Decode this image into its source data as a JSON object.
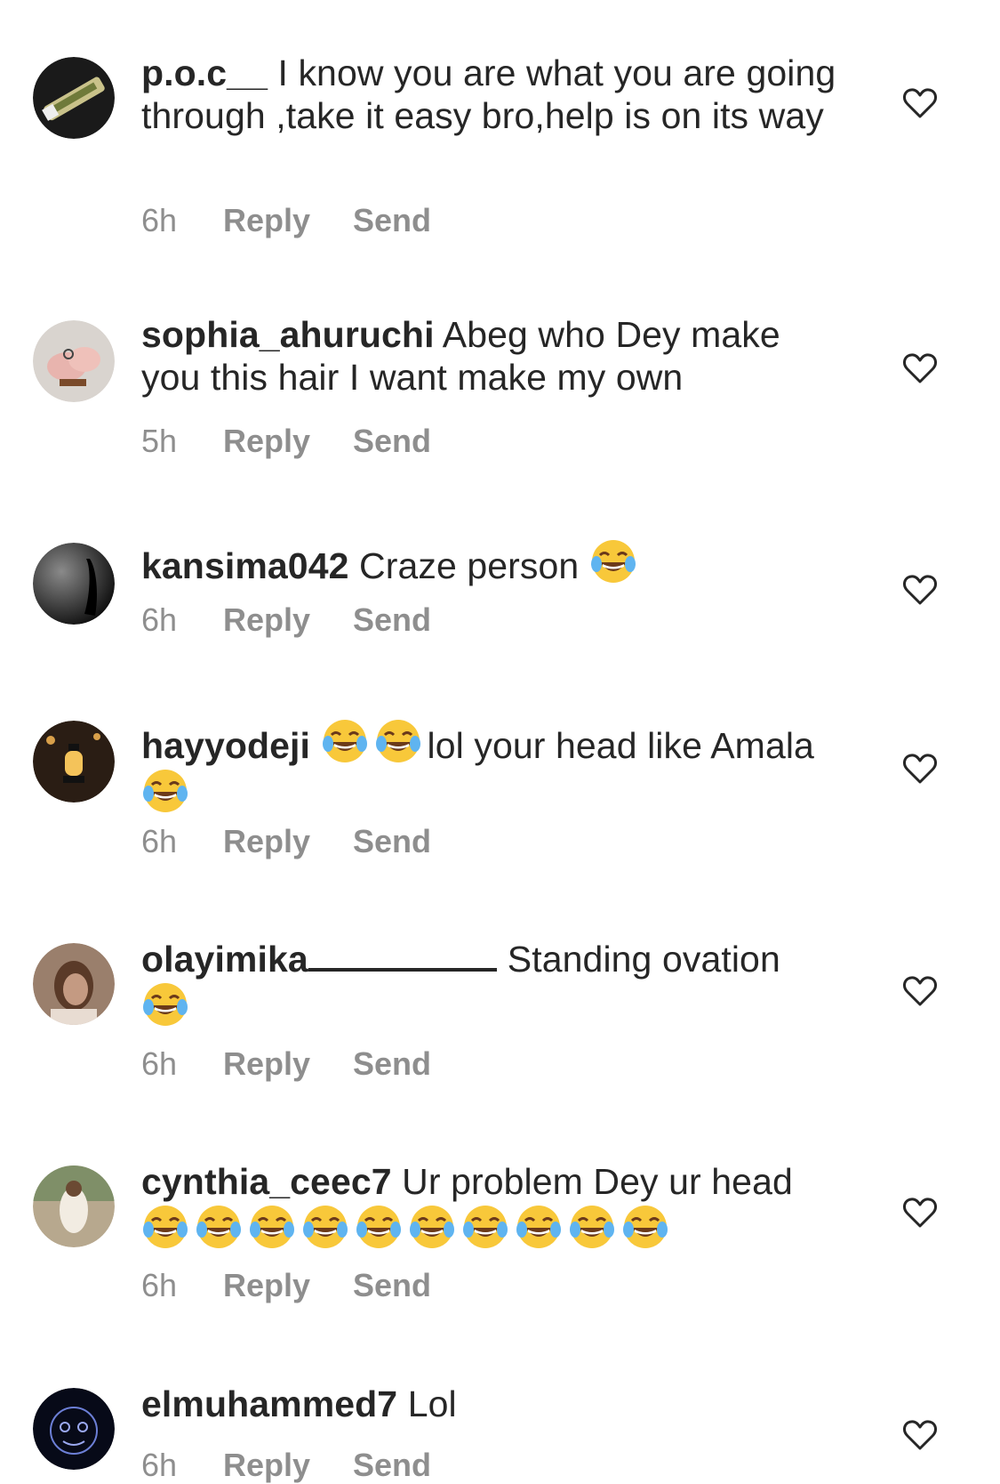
{
  "comments": [
    {
      "username": "p.o.c__",
      "text": " I know you are what you are going through ,take it easy bro,help is on its way",
      "time": "6h",
      "reply": "Reply",
      "send": "Send"
    },
    {
      "username": "sophia_ahuruchi",
      "text": " Abeg who Dey make you this hair I want make my own",
      "time": "5h",
      "reply": "Reply",
      "send": "Send"
    },
    {
      "username": "kansima042",
      "text": " Craze person ",
      "time": "6h",
      "reply": "Reply",
      "send": "Send"
    },
    {
      "username": "hayyodeji",
      "text": "lol your head like Amala",
      "time": "6h",
      "reply": "Reply",
      "send": "Send"
    },
    {
      "username": "olayimika",
      "text": "Standing ovation",
      "time": "6h",
      "reply": "Reply",
      "send": "Send"
    },
    {
      "username": "cynthia_ceec7",
      "text": " Ur problem Dey ur head",
      "time": "6h",
      "reply": "Reply",
      "send": "Send"
    },
    {
      "username": "elmuhammed7",
      "text": " Lol",
      "time": "6h",
      "reply": "Reply",
      "send": "Send"
    }
  ],
  "icons": {
    "like": "heart-outline-icon",
    "emoji": "face-with-tears-of-joy"
  },
  "colors": {
    "text": "#262626",
    "meta": "#8e8e8e",
    "background": "#ffffff"
  }
}
